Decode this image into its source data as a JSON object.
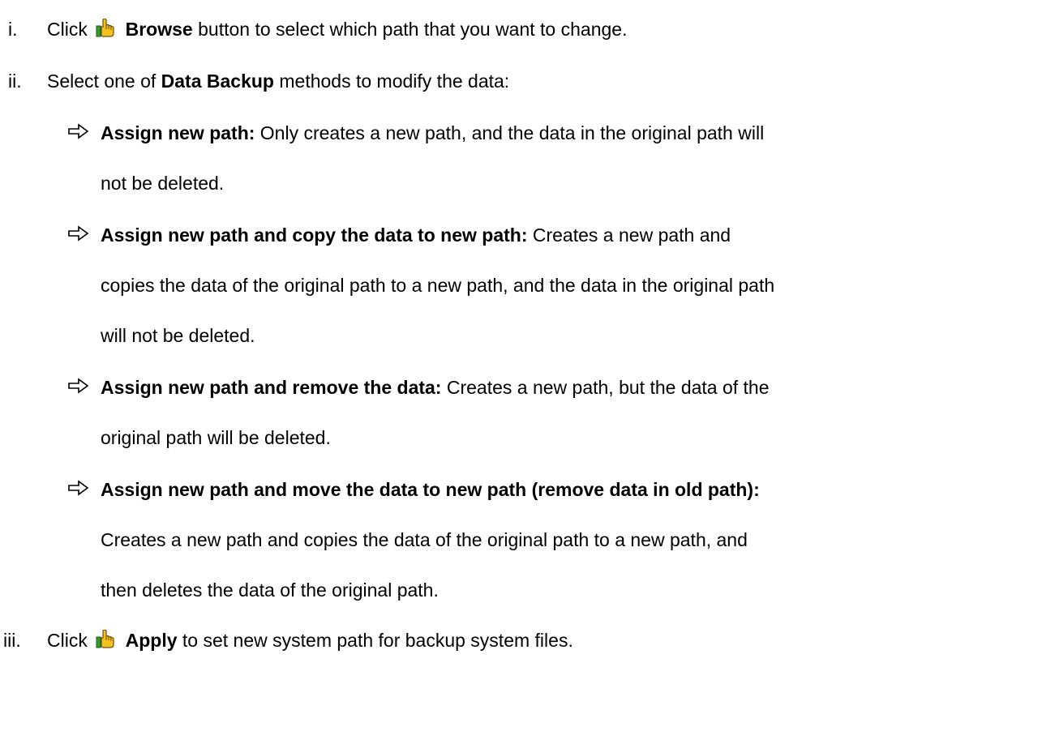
{
  "items": [
    {
      "num": "i.",
      "pre": "Click",
      "icon": "hand-pointer-icon",
      "bold": "Browse",
      "post": " button to select which path that you want to change."
    },
    {
      "num": "ii.",
      "pre": "Select one of ",
      "bold": "Data Backup",
      "post": " methods to modify the data:"
    },
    {
      "num": "iii.",
      "pre": "Click",
      "icon": "hand-pointer-icon",
      "bold": "Apply",
      "post": " to set new system path for backup system files."
    }
  ],
  "methods": [
    {
      "title": "Assign new path:",
      "lines": [
        " Only creates a new path, and the data in the original path will",
        "not be deleted."
      ]
    },
    {
      "title": "Assign new path and copy the data to new path:",
      "lines": [
        " Creates a new path and",
        "copies the data of the original path to a new path, and the data in the original path",
        "will not be deleted."
      ]
    },
    {
      "title": "Assign new path and remove the data:",
      "lines": [
        " Creates a new path, but the data of the",
        "original path will be deleted."
      ]
    },
    {
      "title": "Assign new path and move the data to new path (remove data in old path):",
      "lines": [
        "",
        "Creates a new path and copies the data of the original path to a new path, and",
        "then deletes the data of the original path."
      ]
    }
  ],
  "colors": {
    "icon_brown": "#6b4a1a",
    "icon_green": "#3a9a2a",
    "icon_yellow": "#f2c21e"
  }
}
